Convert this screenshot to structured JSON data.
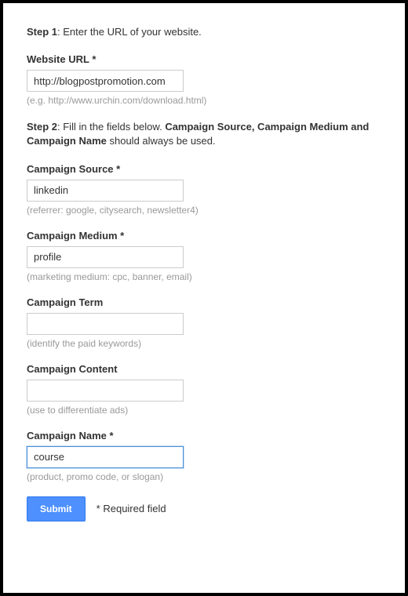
{
  "step1": {
    "label": "Step 1",
    "text": ": Enter the URL of your website."
  },
  "step2": {
    "label": "Step 2",
    "text_before": ": Fill in the fields below. ",
    "text_bold": "Campaign Source, Campaign Medium and Campaign Name",
    "text_after": " should always be used."
  },
  "fields": {
    "website_url": {
      "label": "Website URL *",
      "value": "http://blogpostpromotion.com",
      "hint": "(e.g. http://www.urchin.com/download.html)"
    },
    "campaign_source": {
      "label": "Campaign Source *",
      "value": "linkedin",
      "hint": "(referrer: google, citysearch, newsletter4)"
    },
    "campaign_medium": {
      "label": "Campaign Medium *",
      "value": "profile",
      "hint": "(marketing medium: cpc, banner, email)"
    },
    "campaign_term": {
      "label": "Campaign Term",
      "value": "",
      "hint": "(identify the paid keywords)"
    },
    "campaign_content": {
      "label": "Campaign Content",
      "value": "",
      "hint": "(use to differentiate ads)"
    },
    "campaign_name": {
      "label": "Campaign Name *",
      "value": "course",
      "hint": "(product, promo code, or slogan)"
    }
  },
  "submit": {
    "label": "Submit",
    "required_note": "* Required field"
  }
}
